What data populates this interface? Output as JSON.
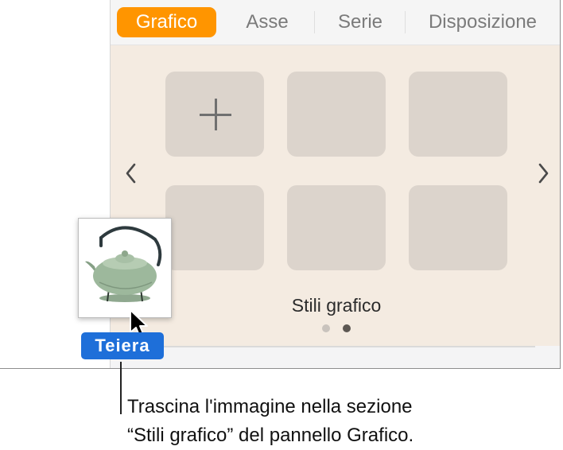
{
  "tabs": [
    {
      "label": "Grafico",
      "active": true
    },
    {
      "label": "Asse",
      "active": false
    },
    {
      "label": "Serie",
      "active": false
    },
    {
      "label": "Disposizione",
      "active": false
    }
  ],
  "chart_styles": {
    "label": "Stili grafico",
    "page_count": 2,
    "current_page": 2,
    "add_icon": "plus-icon",
    "prev_icon": "chevron-left-icon",
    "next_icon": "chevron-right-icon"
  },
  "drag": {
    "label": "Teiera",
    "image_icon": "teapot-icon",
    "cursor_icon": "arrow-cursor-icon"
  },
  "callout": {
    "line1": "Trascina l'immagine nella sezione",
    "line2": "“Stili grafico” del pannello Grafico."
  },
  "colors": {
    "active_tab": "#ff9500",
    "styles_background": "#f4ebe1",
    "drag_label": "#1e6fd9"
  }
}
